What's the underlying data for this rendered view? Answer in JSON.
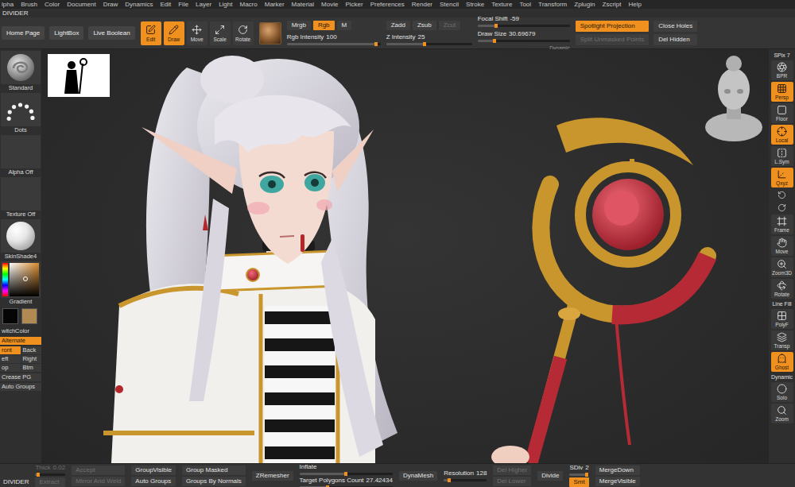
{
  "menu": [
    "lpha",
    "Brush",
    "Color",
    "Document",
    "Draw",
    "Dynamics",
    "Edit",
    "File",
    "Layer",
    "Light",
    "Macro",
    "Marker",
    "Material",
    "Movie",
    "Picker",
    "Preferences",
    "Render",
    "Stencil",
    "Stroke",
    "Texture",
    "Tool",
    "Transform",
    "Zplugin",
    "Zscript",
    "Help"
  ],
  "top_divider": "DIVIDER",
  "shelf": {
    "nav_buttons": [
      "Home Page",
      "LightBox",
      "Live Boolean"
    ],
    "transform_tools": [
      {
        "label": "Edit",
        "selected": true
      },
      {
        "label": "Draw",
        "selected": true
      },
      {
        "label": "Move",
        "selected": false
      },
      {
        "label": "Scale",
        "selected": false
      },
      {
        "label": "Rotate",
        "selected": false
      }
    ],
    "color_mode": [
      {
        "label": "Mrgb",
        "selected": false,
        "disabled": false
      },
      {
        "label": "Rgb",
        "selected": true,
        "disabled": false
      },
      {
        "label": "M",
        "selected": false,
        "disabled": false
      }
    ],
    "rgb_intensity": {
      "label": "Rgb Intensity",
      "value": "100",
      "level": 0.95
    },
    "z_mode": [
      {
        "label": "Zadd",
        "selected": false,
        "disabled": false
      },
      {
        "label": "Zsub",
        "selected": false,
        "disabled": false
      },
      {
        "label": "Zcut",
        "selected": false,
        "disabled": true
      }
    ],
    "z_intensity": {
      "label": "Z Intensity",
      "value": "25",
      "level": 0.45
    },
    "focal_shift": {
      "label": "Focal Shift",
      "value": "-59",
      "level": 0.2
    },
    "draw_size": {
      "label": "Draw Size",
      "value": "30.69679",
      "level": 0.18
    },
    "dynamic": "Dynamic",
    "actions": [
      {
        "label": "Spotlight Projection",
        "selected": true,
        "disabled": false
      },
      {
        "label": "Close Holes",
        "selected": false,
        "disabled": false
      },
      {
        "label": "Split Unmasked Points",
        "selected": false,
        "disabled": true
      },
      {
        "label": "Del Hidden",
        "selected": false,
        "disabled": false
      }
    ]
  },
  "left_tray": {
    "tiles": [
      {
        "kind": "brush",
        "label": "Standard"
      },
      {
        "kind": "stroke",
        "label": "Dots"
      },
      {
        "kind": "alpha",
        "label": "Alpha Off"
      },
      {
        "kind": "texture",
        "label": "Texture Off"
      },
      {
        "kind": "material",
        "label": "SkinShade4"
      }
    ],
    "picker_label": "Gradient",
    "swatches": [
      {
        "color": "#050505"
      },
      {
        "color": "#b08a52"
      }
    ],
    "switch_color": "witchColor",
    "alternate": {
      "label": "Alternate",
      "selected": true
    },
    "views": [
      {
        "label": "ront",
        "selected": true
      },
      {
        "label": "Back",
        "selected": false
      },
      {
        "label": "eft",
        "selected": false
      },
      {
        "label": "Right",
        "selected": false
      },
      {
        "label": "op",
        "selected": false
      },
      {
        "label": "Btm",
        "selected": false
      }
    ],
    "buttons": [
      "Crease PG",
      "Auto Groups"
    ]
  },
  "right_tray": [
    {
      "kind": "header",
      "label": "SPix 7"
    },
    {
      "kind": "button",
      "label": "BPR",
      "selected": false
    },
    {
      "kind": "button",
      "label": "Persp",
      "selected": true
    },
    {
      "kind": "button",
      "label": "Floor",
      "selected": false
    },
    {
      "kind": "button",
      "label": "Local",
      "selected": true
    },
    {
      "kind": "button",
      "label": "L.Sym",
      "selected": false
    },
    {
      "kind": "button",
      "label": "Qxyz",
      "selected": true
    },
    {
      "kind": "icon",
      "selected": false
    },
    {
      "kind": "icon",
      "selected": false
    },
    {
      "kind": "button",
      "label": "Frame",
      "selected": false
    },
    {
      "kind": "button",
      "label": "Move",
      "selected": false
    },
    {
      "kind": "button",
      "label": "Zoom3D",
      "selected": false
    },
    {
      "kind": "button",
      "label": "Rotate",
      "selected": false
    },
    {
      "kind": "header",
      "label": "Line Fill"
    },
    {
      "kind": "button",
      "label": "PolyF",
      "selected": false
    },
    {
      "kind": "button",
      "label": "Transp",
      "selected": false
    },
    {
      "kind": "button",
      "label": "Ghost",
      "selected": true
    },
    {
      "kind": "header",
      "label": "Dynamic"
    },
    {
      "kind": "button",
      "label": "Solo",
      "selected": false
    },
    {
      "kind": "button",
      "label": "Zoom",
      "selected": false
    }
  ],
  "bottom_shelf": {
    "label": "DIVIDER",
    "groups": [
      [
        {
          "kind": "slider",
          "label": "Thick",
          "value": "0.02",
          "level": 0.1,
          "disabled": true,
          "selected": false
        },
        {
          "kind": "button",
          "label": "Extract",
          "disabled": true,
          "selected": false
        }
      ],
      [
        {
          "kind": "button",
          "label": "Accept",
          "disabled": true,
          "selected": false
        },
        {
          "kind": "button",
          "label": "Mirror And Weld",
          "disabled": true,
          "selected": false
        }
      ],
      [
        {
          "kind": "button",
          "label": "GroupVisible",
          "disabled": false,
          "selected": false
        },
        {
          "kind": "button",
          "label": "Auto Groups",
          "disabled": false,
          "selected": false
        }
      ],
      [
        {
          "kind": "button",
          "label": "Group Masked",
          "disabled": false,
          "selected": false
        },
        {
          "kind": "button",
          "label": "Groups By Normals",
          "disabled": false,
          "selected": false
        }
      ],
      [
        {
          "kind": "button",
          "label": "ZRemesher",
          "disabled": false,
          "selected": false
        }
      ],
      [
        {
          "kind": "slider",
          "label": "Inflate",
          "value": "",
          "level": 0.5,
          "disabled": false,
          "selected": false
        },
        {
          "kind": "slider",
          "label": "Target Polygons Count",
          "value": "27.42434",
          "level": 0.3,
          "disabled": false,
          "selected": false
        }
      ],
      [
        {
          "kind": "button",
          "label": "DynaMesh",
          "disabled": false,
          "selected": false
        }
      ],
      [
        {
          "kind": "slider",
          "label": "Resolution",
          "value": "128",
          "level": 0.12,
          "disabled": false,
          "selected": false
        }
      ],
      [
        {
          "kind": "button",
          "label": "Del Higher",
          "disabled": true,
          "selected": false
        },
        {
          "kind": "button",
          "label": "Del Lower",
          "disabled": true,
          "selected": false
        }
      ],
      [
        {
          "kind": "button",
          "label": "Divide",
          "disabled": false,
          "selected": false
        }
      ],
      [
        {
          "kind": "slider",
          "label": "SDiv",
          "value": "2",
          "level": 0.9,
          "disabled": false,
          "selected": false
        },
        {
          "kind": "button",
          "label": "Smt",
          "disabled": false,
          "selected": true
        }
      ],
      [
        {
          "kind": "button",
          "label": "MergeDown",
          "disabled": false,
          "selected": false
        },
        {
          "kind": "button",
          "label": "MergeVisible",
          "disabled": false,
          "selected": false
        }
      ]
    ]
  }
}
